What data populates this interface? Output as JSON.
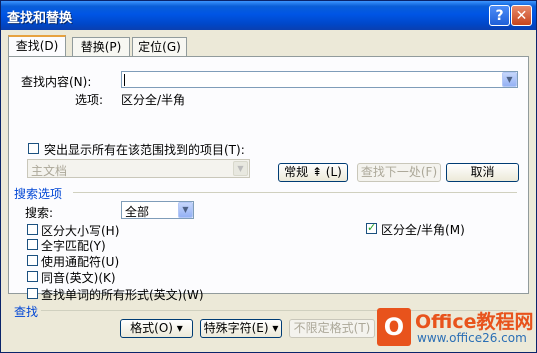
{
  "window": {
    "title": "查找和替换"
  },
  "tabs": [
    {
      "label": "查找(D)"
    },
    {
      "label": "替换(P)"
    },
    {
      "label": "定位(G)"
    }
  ],
  "find": {
    "label": "查找内容(N):",
    "value": "",
    "options_label": "选项:",
    "options_value": "区分全/半角"
  },
  "highlight": {
    "label": "突出显示所有在该范围找到的项目(T):",
    "checked": false,
    "scope_value": "主文档"
  },
  "buttons": {
    "normal": "常规 ⇞ (L)",
    "find_next": "查找下一处(F)",
    "cancel": "取消",
    "format": "格式(O) ▾",
    "special": "特殊字符(E) ▾",
    "no_format": "不限定格式(T)"
  },
  "search_options": {
    "section_label": "搜索选项",
    "search_label": "搜索:",
    "search_value": "全部",
    "checkboxes": [
      {
        "label": "区分大小写(H)",
        "checked": false
      },
      {
        "label": "全字匹配(Y)",
        "checked": false
      },
      {
        "label": "使用通配符(U)",
        "checked": false
      },
      {
        "label": "同音(英文)(K)",
        "checked": false
      },
      {
        "label": "查找单词的所有形式(英文)(W)",
        "checked": false
      }
    ],
    "fullwidth": {
      "label": "区分全/半角(M)",
      "checked": true
    }
  },
  "find_section_label": "查找",
  "watermark": {
    "name": "Office教程网",
    "url": "www.office26.com",
    "brand_color": "#e8531c"
  }
}
